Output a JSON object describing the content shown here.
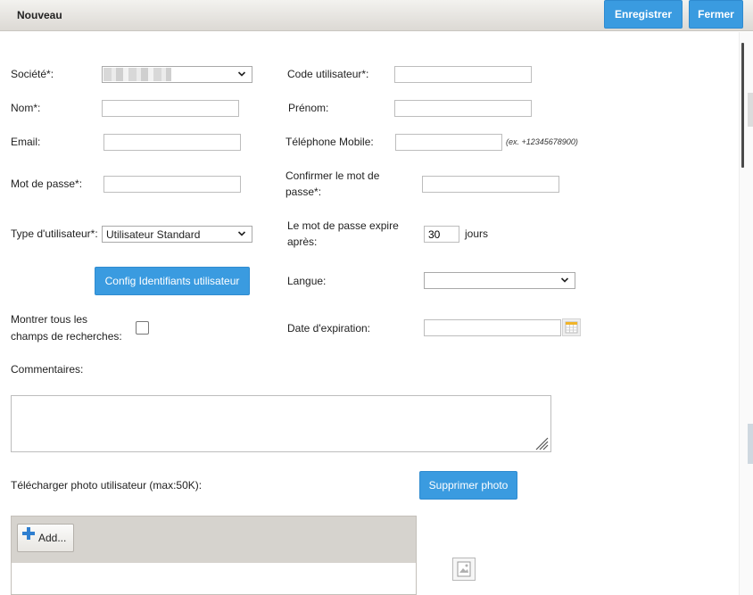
{
  "window": {
    "title": "Nouveau"
  },
  "toolbar": {
    "save_label": "Enregistrer",
    "close_label": "Fermer"
  },
  "form": {
    "societe": {
      "label": "Société*:",
      "value": ""
    },
    "code_utilisateur": {
      "label": "Code utilisateur*:",
      "value": ""
    },
    "nom": {
      "label": "Nom*:",
      "value": ""
    },
    "prenom": {
      "label": "Prénom:",
      "value": ""
    },
    "email": {
      "label": "Email:",
      "value": ""
    },
    "telephone": {
      "label": "Téléphone Mobile:",
      "value": "",
      "hint": "(ex. +12345678900)"
    },
    "mot_de_passe": {
      "label": "Mot de passe*:",
      "value": ""
    },
    "confirmer": {
      "label_line1": "Confirmer le mot de",
      "label_line2": "passe*:",
      "value": ""
    },
    "type_utilisateur": {
      "label": "Type d'utilisateur*:",
      "value": "Utilisateur Standard"
    },
    "expire": {
      "label_line1": "Le mot de passe expire",
      "label_line2": "après:",
      "value": "30",
      "unit": "jours"
    },
    "config_button": "Config Identifiants utilisateur",
    "langue": {
      "label": "Langue:",
      "value": ""
    },
    "montrer": {
      "label_line1": "Montrer tous les",
      "label_line2": "champs de recherches:",
      "checked": false
    },
    "date_expiration": {
      "label": "Date d'expiration:",
      "value": ""
    },
    "commentaires": {
      "label": "Commentaires:",
      "value": ""
    },
    "photo": {
      "label": "Télécharger photo utilisateur (max:50K):",
      "delete_button": "Supprimer photo",
      "add_label": "Add..."
    }
  },
  "colors": {
    "accent": "#3a9be0",
    "titlebar": "#e4e1dc"
  },
  "icons": {
    "add": "plus-icon",
    "calendar": "calendar-icon",
    "chevron": "chevron-down-icon",
    "photo": "image-placeholder-icon"
  }
}
